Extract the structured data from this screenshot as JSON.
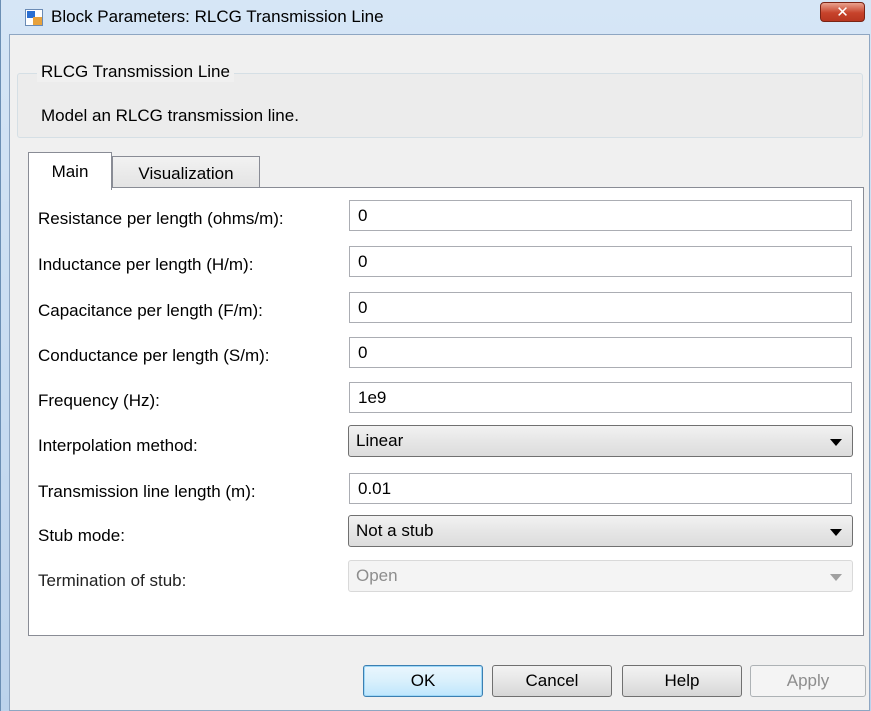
{
  "window": {
    "title": "Block Parameters: RLCG Transmission Line",
    "close_glyph": "✕"
  },
  "description": {
    "group_title": "RLCG Transmission Line",
    "text": "Model an RLCG transmission line."
  },
  "tabs": [
    {
      "label": "Main",
      "selected": true
    },
    {
      "label": "Visualization",
      "selected": false
    }
  ],
  "params": {
    "resistance": {
      "label": "Resistance per length (ohms/m):",
      "value": "0"
    },
    "inductance": {
      "label": "Inductance per length (H/m):",
      "value": "0"
    },
    "capacitance": {
      "label": "Capacitance per length (F/m):",
      "value": "0"
    },
    "conductance": {
      "label": "Conductance per length (S/m):",
      "value": "0"
    },
    "frequency": {
      "label": "Frequency (Hz):",
      "value": "1e9"
    },
    "interpolation": {
      "label": "Interpolation method:",
      "value": "Linear"
    },
    "line_length": {
      "label": "Transmission line length (m):",
      "value": "0.01"
    },
    "stub_mode": {
      "label": "Stub mode:",
      "value": "Not a stub"
    },
    "termination": {
      "label": "Termination of stub:",
      "value": "Open",
      "disabled": true
    }
  },
  "buttons": {
    "ok": "OK",
    "cancel": "Cancel",
    "help": "Help",
    "apply": "Apply"
  },
  "colors": {
    "accent": "#3c7fb1",
    "close": "#c7432b"
  }
}
